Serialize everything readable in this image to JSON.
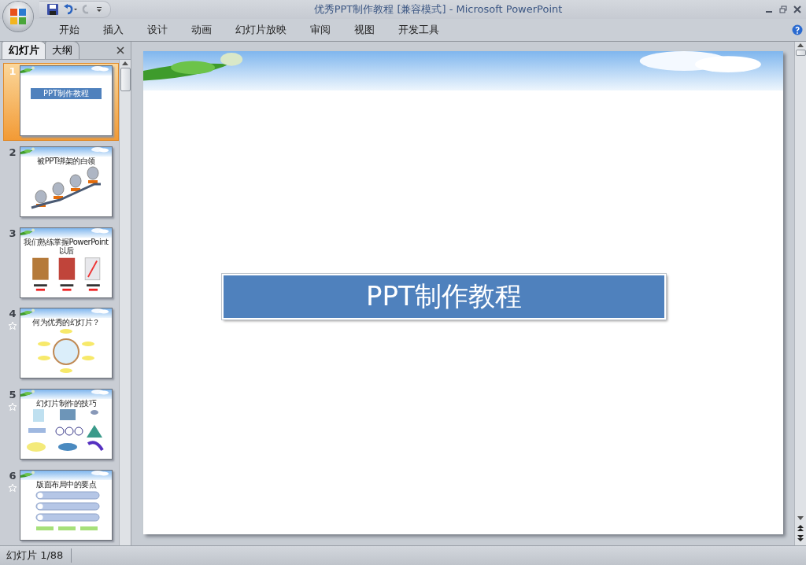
{
  "window": {
    "title": "优秀PPT制作教程 [兼容模式] - Microsoft PowerPoint"
  },
  "ribbon_tabs": [
    {
      "label": "开始",
      "selected": false
    },
    {
      "label": "插入",
      "selected": false
    },
    {
      "label": "设计",
      "selected": false
    },
    {
      "label": "动画",
      "selected": false
    },
    {
      "label": "幻灯片放映",
      "selected": false
    },
    {
      "label": "审阅",
      "selected": false
    },
    {
      "label": "视图",
      "selected": false
    },
    {
      "label": "开发工具",
      "selected": false
    }
  ],
  "pane_tabs": [
    {
      "label": "幻灯片",
      "selected": true
    },
    {
      "label": "大纲",
      "selected": false
    }
  ],
  "slides": [
    {
      "number": "1",
      "kind": "title",
      "title": "PPT制作教程",
      "animated": false,
      "selected": true
    },
    {
      "number": "2",
      "kind": "steps",
      "title": "被PPT绑架的白领",
      "animated": false,
      "selected": false
    },
    {
      "number": "3",
      "kind": "images",
      "title": "我们熟练掌握PowerPoint以后",
      "animated": false,
      "selected": false
    },
    {
      "number": "4",
      "kind": "circle",
      "title": "何为优秀的幻灯片？",
      "animated": true,
      "selected": false
    },
    {
      "number": "5",
      "kind": "grid",
      "title": "幻灯片制作的技巧",
      "animated": true,
      "selected": false
    },
    {
      "number": "6",
      "kind": "bars",
      "title": "版面布局中的要点",
      "animated": true,
      "selected": false
    }
  ],
  "current_slide": {
    "title": "PPT制作教程"
  },
  "status_bar": {
    "text": "幻灯片 1/88"
  }
}
